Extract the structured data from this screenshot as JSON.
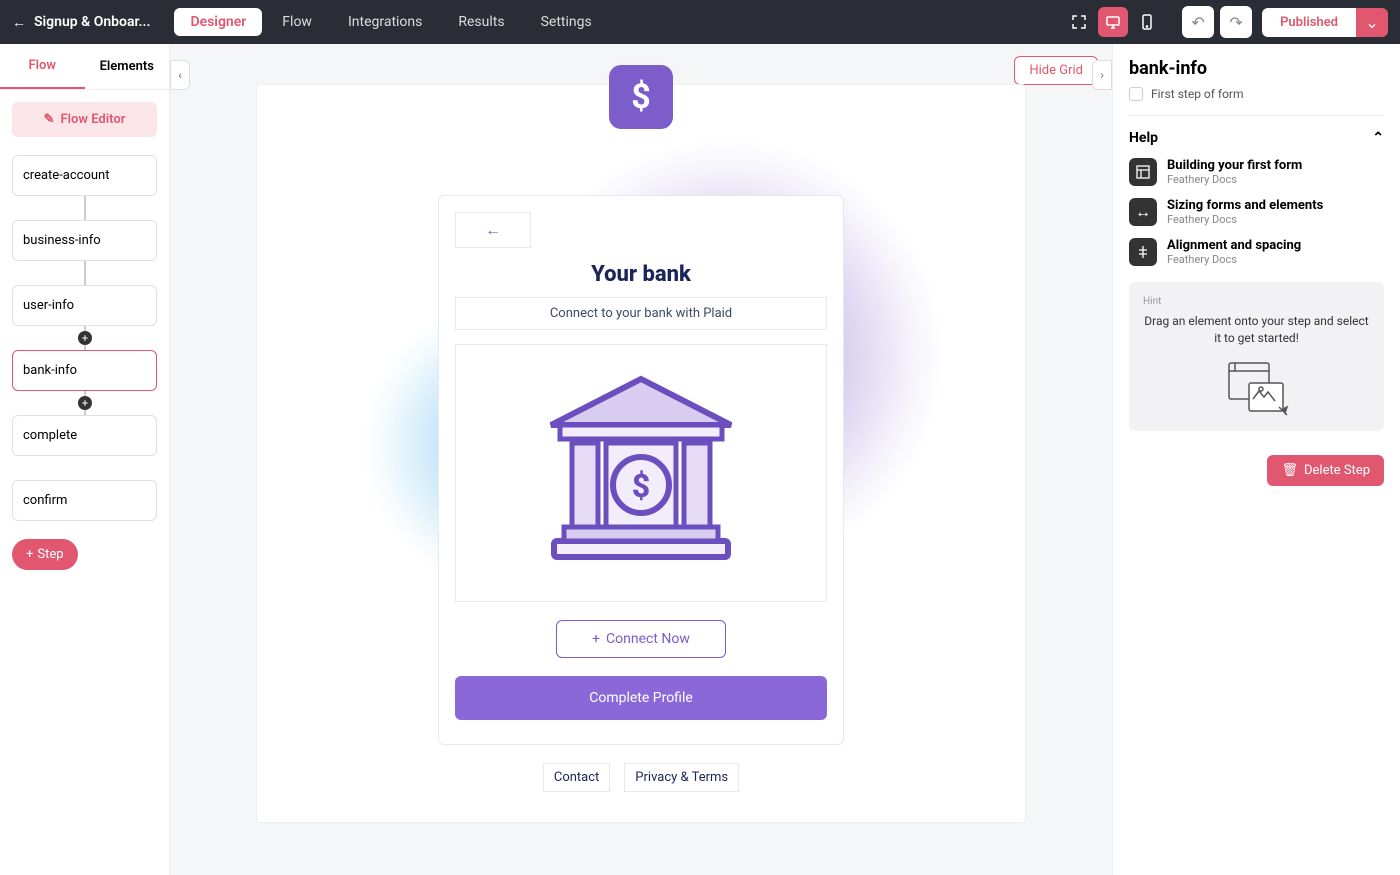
{
  "topbar": {
    "title": "Signup & Onboar...",
    "tabs": [
      "Designer",
      "Flow",
      "Integrations",
      "Results",
      "Settings"
    ],
    "publish_label": "Published"
  },
  "sidebar": {
    "tabs": [
      "Flow",
      "Elements"
    ],
    "flow_editor_label": "Flow Editor",
    "steps": [
      "create-account",
      "business-info",
      "user-info",
      "bank-info",
      "complete",
      "confirm"
    ],
    "add_step_label": "Step"
  },
  "canvas": {
    "hide_grid_label": "Hide Grid",
    "dollar": "$",
    "form": {
      "title": "Your bank",
      "subtitle": "Connect to your bank with Plaid",
      "connect_label": "Connect Now",
      "complete_label": "Complete Profile",
      "footer": [
        "Contact",
        "Privacy & Terms"
      ]
    }
  },
  "right_panel": {
    "title": "bank-info",
    "first_step_label": "First step of form",
    "help_header": "Help",
    "help_items": [
      {
        "title": "Building your first form",
        "sub": "Feathery Docs"
      },
      {
        "title": "Sizing forms and elements",
        "sub": "Feathery Docs"
      },
      {
        "title": "Alignment and spacing",
        "sub": "Feathery Docs"
      }
    ],
    "hint_label": "Hint",
    "hint_text": "Drag an element onto your step and select it to get started!",
    "delete_label": "Delete Step"
  }
}
